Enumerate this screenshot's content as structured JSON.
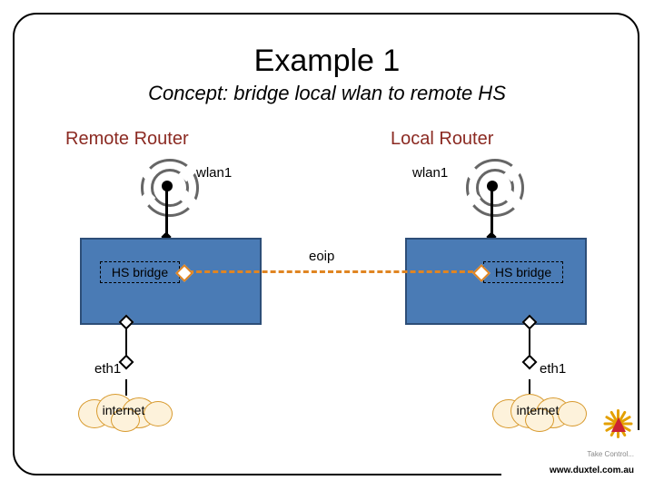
{
  "title": "Example 1",
  "subtitle": "Concept: bridge local wlan to remote HS",
  "remote": {
    "heading": "Remote Router",
    "wlan": "wlan1",
    "bridge": "HS bridge",
    "eth": "eth1",
    "internet": "internet"
  },
  "local": {
    "heading": "Local Router",
    "wlan": "wlan1",
    "bridge": "HS bridge",
    "eth": "eth1",
    "internet": "internet"
  },
  "link": {
    "label": "eoip"
  },
  "logo": {
    "tagline": "Take Control...",
    "url": "www.duxtel.com.au"
  }
}
